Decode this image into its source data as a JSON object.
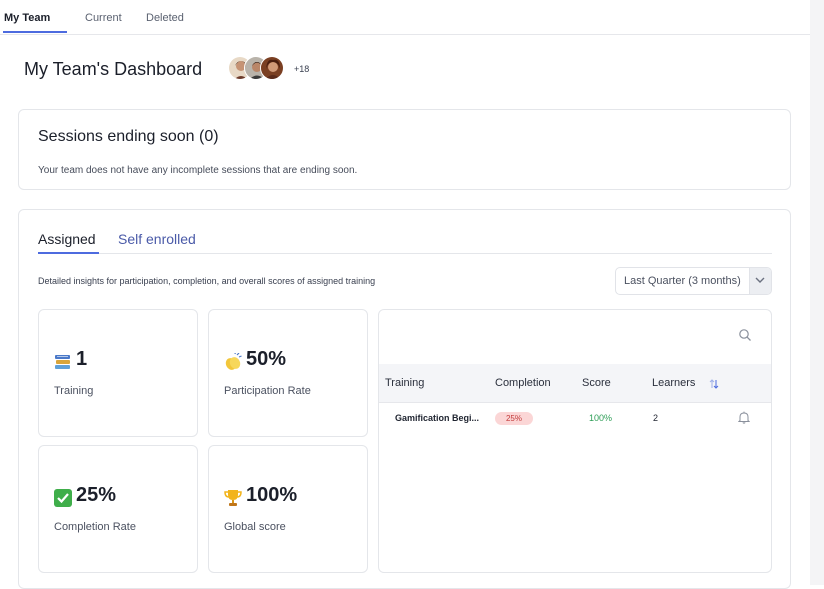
{
  "top_tabs": [
    {
      "label": "My Team",
      "active": true
    },
    {
      "label": "Current",
      "active": false
    },
    {
      "label": "Deleted",
      "active": false
    }
  ],
  "header": {
    "title": "My Team's Dashboard",
    "avatars_more": "+18"
  },
  "sessions": {
    "title": "Sessions ending soon (0)",
    "description": "Your team does not have any incomplete sessions that are ending soon."
  },
  "tabs": [
    {
      "label": "Assigned",
      "active": true
    },
    {
      "label": "Self enrolled",
      "active": false
    }
  ],
  "insights_description": "Detailed insights for participation, completion, and overall scores of assigned training",
  "period_select": {
    "value": "Last Quarter (3 months)"
  },
  "stats": [
    {
      "icon": "books-icon",
      "value": "1",
      "label": "Training"
    },
    {
      "icon": "clapping-hands-icon",
      "value": "50%",
      "label": "Participation Rate"
    },
    {
      "icon": "check-mark-icon",
      "value": "25%",
      "label": "Completion Rate"
    },
    {
      "icon": "trophy-icon",
      "value": "100%",
      "label": "Global score"
    }
  ],
  "table": {
    "columns": [
      "Training",
      "Completion",
      "Score",
      "Learners"
    ],
    "rows": [
      {
        "training": "Gamification Begi...",
        "completion": "25%",
        "score": "100%",
        "learners": "2"
      }
    ]
  },
  "colors": {
    "accent": "#4d6bdf",
    "score_green": "#2e9e57",
    "completion_badge_bg": "#fbd6d6",
    "completion_badge_text": "#c23a3a"
  }
}
